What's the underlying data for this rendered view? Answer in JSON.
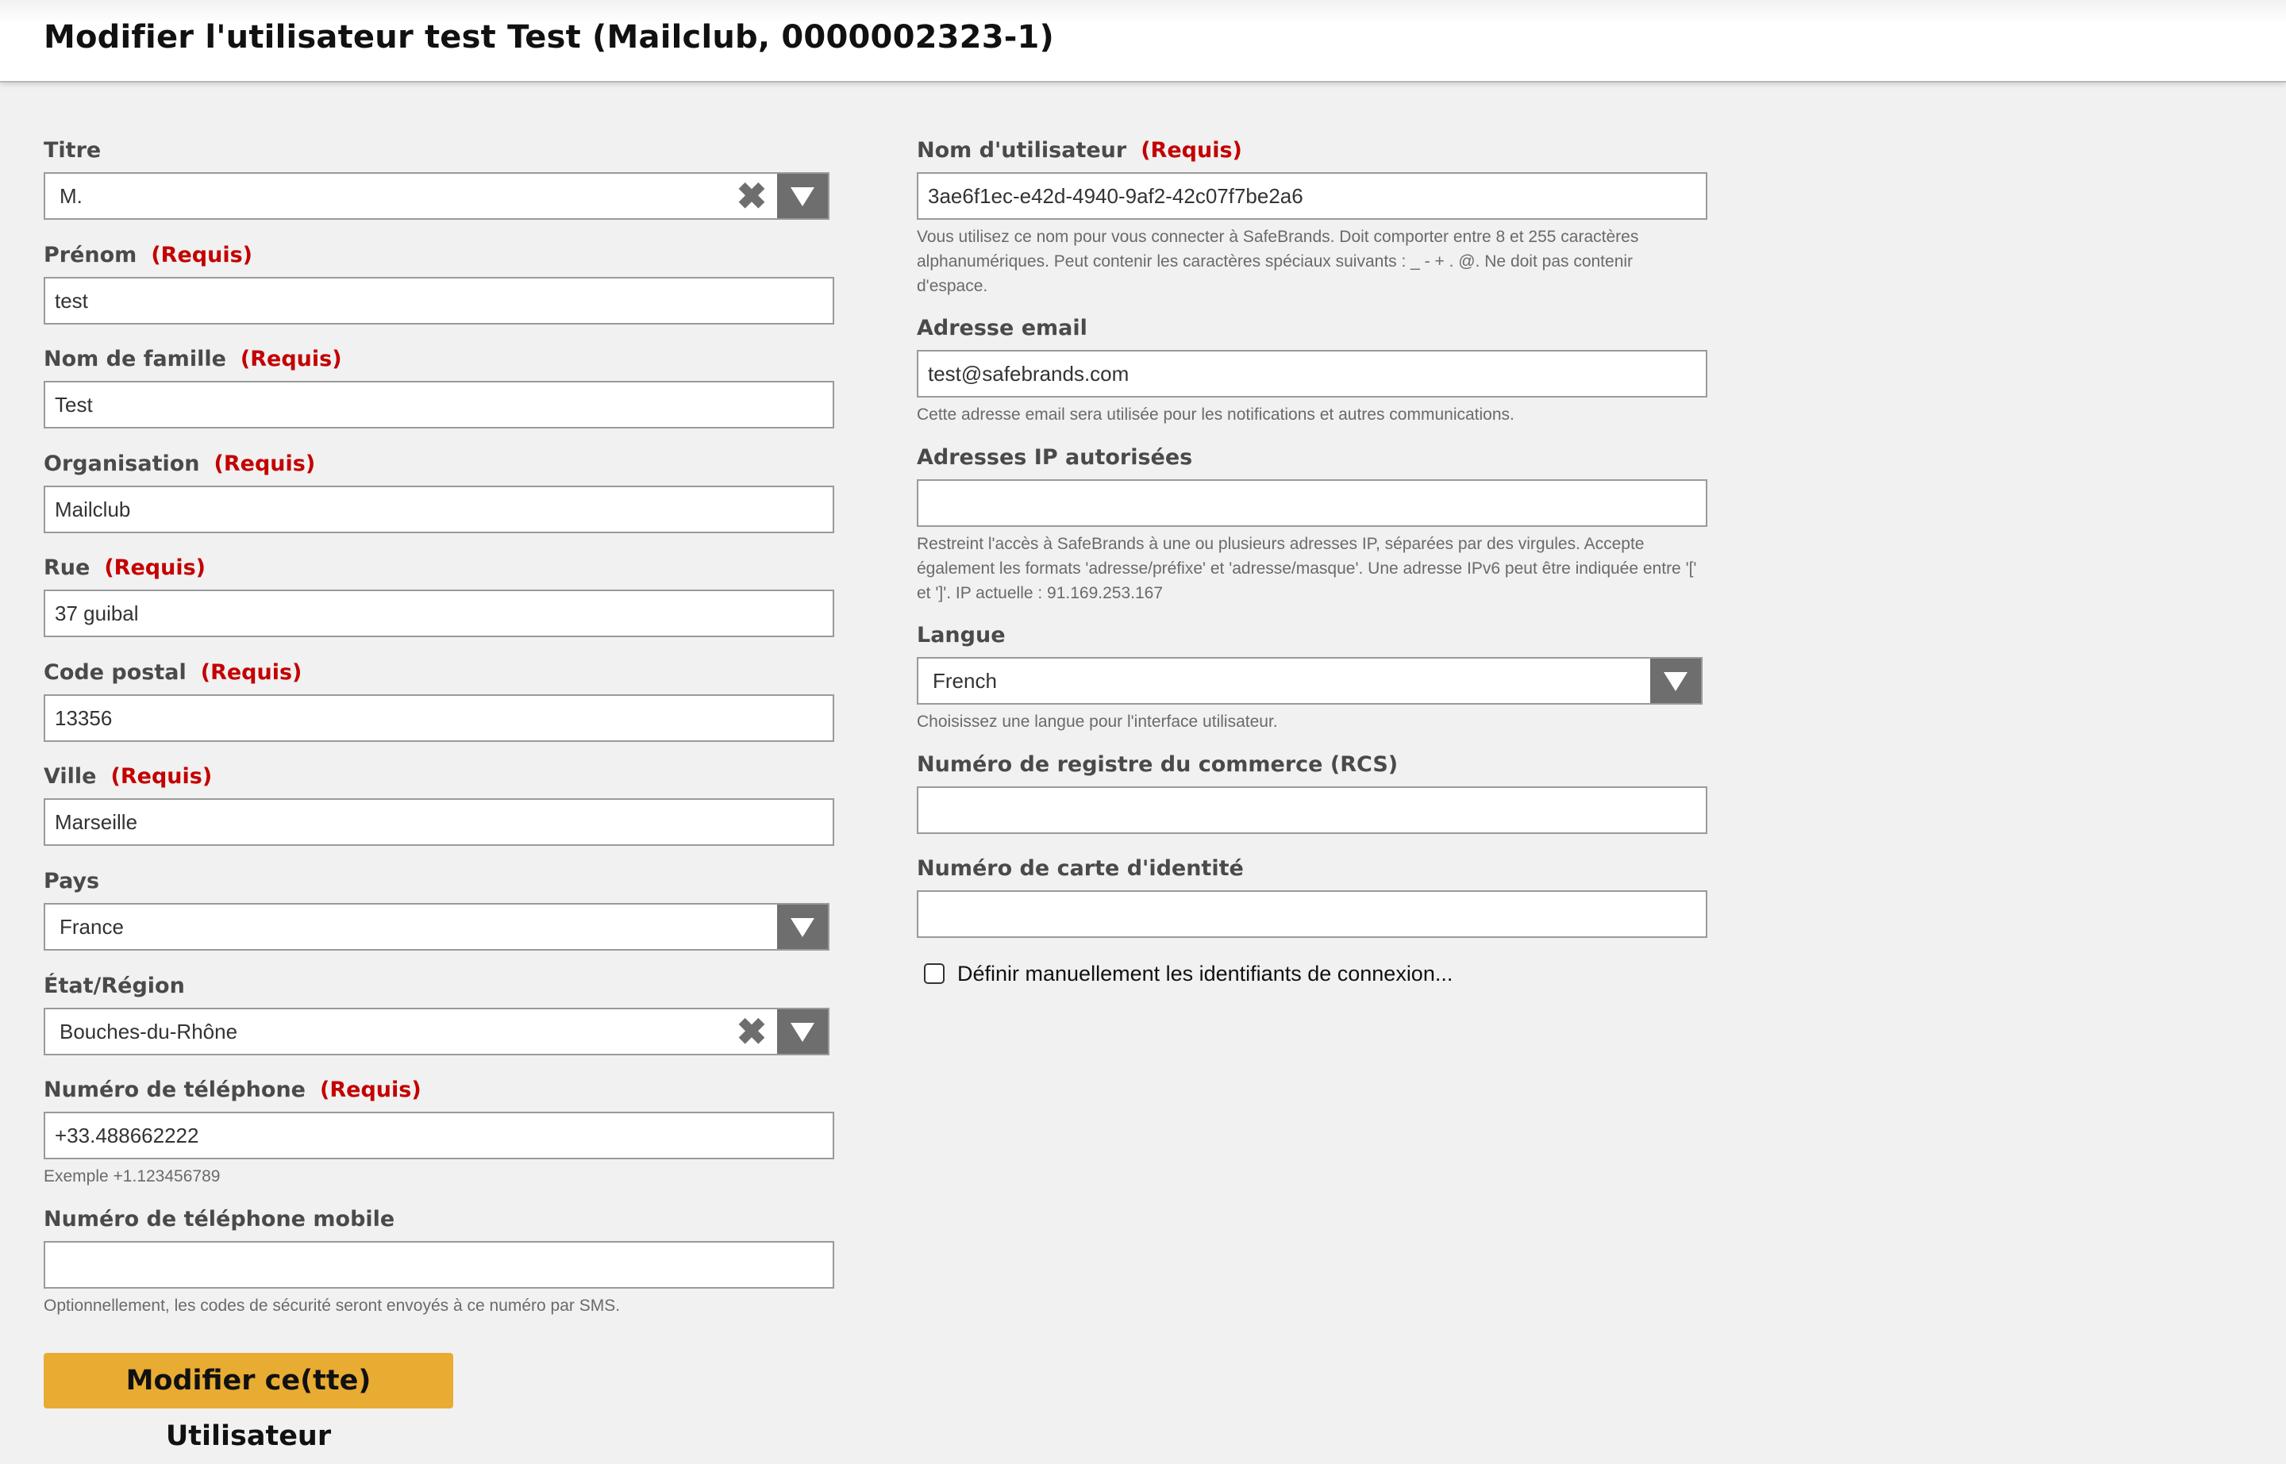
{
  "page_title": "Modifier l'utilisateur test Test (Mailclub, 0000002323-1)",
  "required_text": "(Requis)",
  "left_fields": {
    "titre": {
      "label": "Titre",
      "value": "M."
    },
    "prenom": {
      "label": "Prénom",
      "value": "test"
    },
    "nom_famille": {
      "label": "Nom de famille",
      "value": "Test"
    },
    "organisation": {
      "label": "Organisation",
      "value": "Mailclub"
    },
    "rue": {
      "label": "Rue",
      "value": "37 guibal"
    },
    "code_postal": {
      "label": "Code postal",
      "value": "13356"
    },
    "ville": {
      "label": "Ville",
      "value": "Marseille"
    },
    "pays": {
      "label": "Pays",
      "value": "France"
    },
    "etat_region": {
      "label": "État/Région",
      "value": "Bouches-du-Rhône"
    },
    "telephone": {
      "label": "Numéro de téléphone",
      "value": "+33.488662222",
      "help": "Exemple +1.123456789"
    },
    "telephone_mobile": {
      "label": "Numéro de téléphone mobile",
      "value": "",
      "help": "Optionnellement, les codes de sécurité seront envoyés à ce numéro par SMS."
    }
  },
  "right_fields": {
    "nom_utilisateur": {
      "label": "Nom d'utilisateur",
      "value": "3ae6f1ec-e42d-4940-9af2-42c07f7be2a6",
      "help": "Vous utilisez ce nom pour vous connecter à SafeBrands. Doit comporter entre 8 et 255 caractères alphanumériques. Peut contenir les caractères spéciaux suivants : _ - + . @. Ne doit pas contenir d'espace."
    },
    "email": {
      "label": "Adresse email",
      "value": "test@safebrands.com",
      "help": "Cette adresse email sera utilisée pour les notifications et autres communications."
    },
    "ip": {
      "label": "Adresses IP autorisées",
      "value": "",
      "help": "Restreint l'accès à SafeBrands à une ou plusieurs adresses IP, séparées par des virgules. Accepte également les formats 'adresse/préfixe' et 'adresse/masque'. Une adresse IPv6 peut être indiquée entre '[' et ']'. IP actuelle : 91.169.253.167"
    },
    "langue": {
      "label": "Langue",
      "value": "French",
      "help": "Choisissez une langue pour l'interface utilisateur."
    },
    "rcs": {
      "label": "Numéro de registre du commerce (RCS)",
      "value": ""
    },
    "carte_identite": {
      "label": "Numéro de carte d'identité",
      "value": ""
    }
  },
  "manual_credentials_label": "Définir manuellement les identifiants de connexion...",
  "submit_label": "Modifier ce(tte) Utilisateur",
  "colors": {
    "required": "#c40000",
    "submit_bg": "#e8ac33",
    "select_arrow_bg": "#6e6e6e",
    "page_bg": "#f1f1f1"
  },
  "icons": [
    "clear-icon",
    "dropdown-arrow-icon",
    "checkbox-icon"
  ]
}
